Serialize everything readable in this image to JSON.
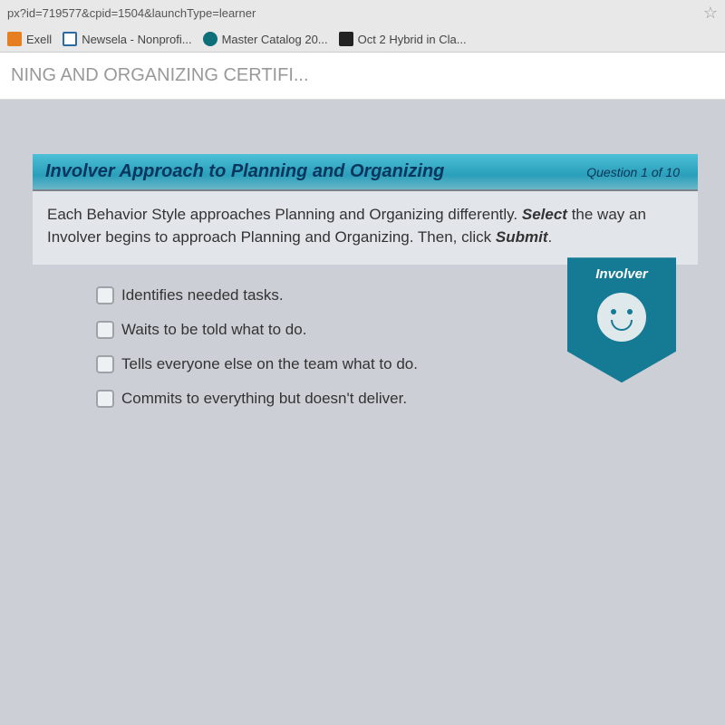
{
  "browser": {
    "url_fragment": "px?id=719577&cpid=1504&launchType=learner",
    "bookmarks": [
      {
        "label": "Exell",
        "iconClass": "i-orange"
      },
      {
        "label": "Newsela - Nonprofi...",
        "iconClass": "i-blue"
      },
      {
        "label": "Master Catalog 20...",
        "iconClass": "i-teal"
      },
      {
        "label": "Oct 2 Hybrid in Cla...",
        "iconClass": "i-dark"
      }
    ]
  },
  "course_title": "NING AND ORGANIZING CERTIFI...",
  "header": {
    "title": "Involver Approach to Planning and Organizing",
    "question_counter": "Question 1 of 10"
  },
  "prompt": {
    "pre": "Each Behavior Style approaches Planning and Organizing differently. ",
    "bold1": "Select",
    "mid": " the way an Involver begins to approach Planning and Organizing. Then, click ",
    "bold2": "Submit",
    "post": "."
  },
  "badge_label": "Involver",
  "options": [
    "Identifies needed tasks.",
    "Waits to be told what to do.",
    "Tells everyone else on the team what to do.",
    "Commits to everything but doesn't deliver."
  ]
}
